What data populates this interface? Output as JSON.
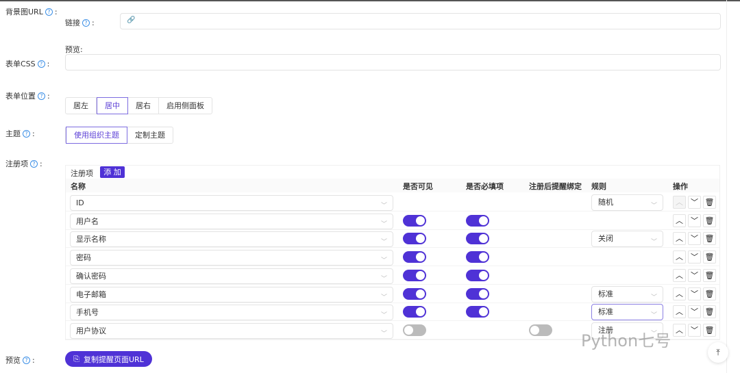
{
  "labels": {
    "bg_url": "背景图URL",
    "link": "链接",
    "preview_sub": "预览:",
    "form_css": "表单CSS",
    "form_pos": "表单位置",
    "theme": "主题",
    "reg_items": "注册项",
    "preview": "预览"
  },
  "colon": ":",
  "help": "?",
  "position_options": [
    "居左",
    "居中",
    "居右",
    "启用侧面板"
  ],
  "position_selected": "居中",
  "theme_options": [
    "使用组织主题",
    "定制主题"
  ],
  "table": {
    "title": "注册项",
    "add_label": "添 加",
    "headers": [
      "名称",
      "是否可见",
      "是否必填项",
      "注册后提醒绑定",
      "规则",
      "操作"
    ],
    "rows": [
      {
        "name": "ID",
        "visible": null,
        "required": null,
        "bind": null,
        "rule": "随机",
        "up_disabled": true
      },
      {
        "name": "用户名",
        "visible": true,
        "required": true,
        "bind": null,
        "rule": null
      },
      {
        "name": "显示名称",
        "visible": true,
        "required": true,
        "bind": null,
        "rule": "关闭"
      },
      {
        "name": "密码",
        "visible": true,
        "required": true,
        "bind": null,
        "rule": null
      },
      {
        "name": "确认密码",
        "visible": true,
        "required": true,
        "bind": null,
        "rule": null
      },
      {
        "name": "电子邮箱",
        "visible": true,
        "required": true,
        "bind": null,
        "rule": "标准"
      },
      {
        "name": "手机号",
        "visible": true,
        "required": true,
        "bind": null,
        "rule": "标准",
        "focused": true
      },
      {
        "name": "用户协议",
        "visible": false,
        "required": null,
        "bind": false,
        "rule": "注册"
      }
    ]
  },
  "copy_button": "复制提醒页面URL",
  "watermark": "Python七号",
  "accent": "#4f32d6"
}
